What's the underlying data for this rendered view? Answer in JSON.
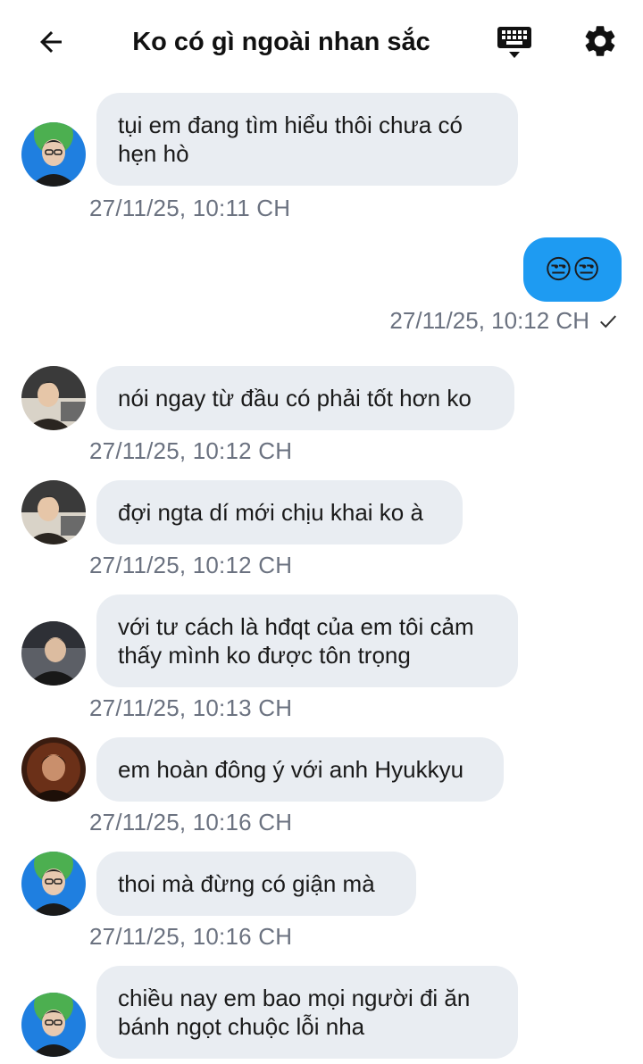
{
  "header": {
    "title": "Ko có gì ngoài nhan sắc",
    "back_icon": "arrow-left-icon",
    "keyboard_icon": "keyboard-icon",
    "settings_icon": "gear-icon"
  },
  "colors": {
    "incoming_bubble": "#e9edf2",
    "outgoing_bubble": "#1e9bf2",
    "timestamp": "#6b7280"
  },
  "messages": [
    {
      "direction": "in",
      "text": "tụi em đang tìm hiểu thôi chưa có hẹn hò",
      "time": "27/11/25, 10:11 CH"
    },
    {
      "direction": "out",
      "text": "😒😒",
      "time": "27/11/25, 10:12 CH",
      "status_icon": "check-icon"
    },
    {
      "direction": "in",
      "text": "nói ngay từ đầu có phải tốt hơn ko",
      "time": "27/11/25, 10:12 CH"
    },
    {
      "direction": "in",
      "text": "đợi ngta dí mới chịu khai ko à",
      "time": "27/11/25, 10:12 CH"
    },
    {
      "direction": "in",
      "text": "với tư cách là hđqt của em tôi cảm thấy mình ko được tôn trọng",
      "time": "27/11/25, 10:13 CH"
    },
    {
      "direction": "in",
      "text": "em hoàn đông ý với anh Hyukkyu",
      "time": "27/11/25, 10:16 CH"
    },
    {
      "direction": "in",
      "text": "thoi mà đừng có giận mà",
      "time": "27/11/25, 10:16 CH"
    },
    {
      "direction": "in",
      "text": "chiều nay em bao mọi người đi ăn bánh ngọt chuộc lỗi nha",
      "time": ""
    }
  ]
}
